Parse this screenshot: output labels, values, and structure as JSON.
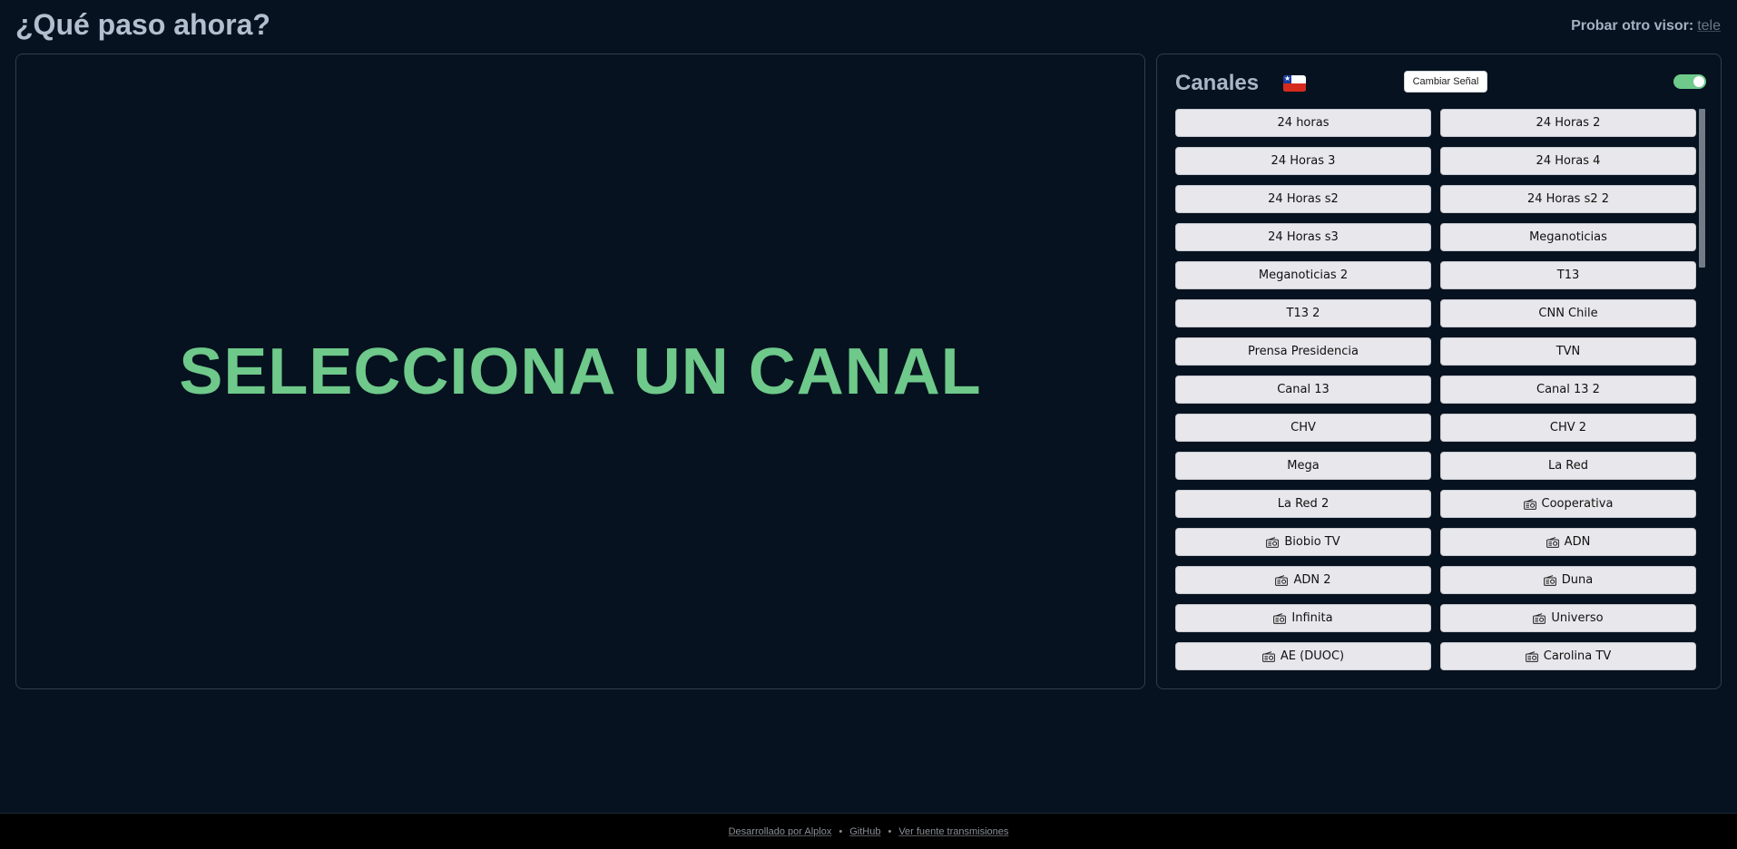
{
  "header": {
    "title": "¿Qué paso ahora?",
    "alt_viewer_label": "Probar otro visor:",
    "alt_viewer_link": "tele"
  },
  "player": {
    "message": "SELECCIONA UN CANAL"
  },
  "sidebar": {
    "title": "Canales",
    "flag": "chile-flag-icon",
    "signal_button": "Cambiar Señal",
    "toggle_on": true,
    "accent_color": "#6ec98a"
  },
  "channels": [
    {
      "label": "24 horas",
      "radio": false
    },
    {
      "label": "24 Horas 2",
      "radio": false
    },
    {
      "label": "24 Horas 3",
      "radio": false
    },
    {
      "label": "24 Horas 4",
      "radio": false
    },
    {
      "label": "24 Horas s2",
      "radio": false
    },
    {
      "label": "24 Horas s2 2",
      "radio": false
    },
    {
      "label": "24 Horas s3",
      "radio": false
    },
    {
      "label": "Meganoticias",
      "radio": false
    },
    {
      "label": "Meganoticias 2",
      "radio": false
    },
    {
      "label": "T13",
      "radio": false
    },
    {
      "label": "T13 2",
      "radio": false
    },
    {
      "label": "CNN Chile",
      "radio": false
    },
    {
      "label": "Prensa Presidencia",
      "radio": false
    },
    {
      "label": "TVN",
      "radio": false
    },
    {
      "label": "Canal 13",
      "radio": false
    },
    {
      "label": "Canal 13 2",
      "radio": false
    },
    {
      "label": "CHV",
      "radio": false
    },
    {
      "label": "CHV 2",
      "radio": false
    },
    {
      "label": "Mega",
      "radio": false
    },
    {
      "label": "La Red",
      "radio": false
    },
    {
      "label": "La Red 2",
      "radio": false
    },
    {
      "label": "Cooperativa",
      "radio": true
    },
    {
      "label": "Biobio TV",
      "radio": true
    },
    {
      "label": "ADN",
      "radio": true
    },
    {
      "label": "ADN 2",
      "radio": true
    },
    {
      "label": "Duna",
      "radio": true
    },
    {
      "label": "Infinita",
      "radio": true
    },
    {
      "label": "Universo",
      "radio": true
    },
    {
      "label": "AE (DUOC)",
      "radio": true
    },
    {
      "label": "Carolina TV",
      "radio": true
    }
  ],
  "footer": {
    "credit": "Desarrollado por Alplox",
    "github": "GitHub",
    "sources": "Ver fuente transmisiones",
    "separator": "•"
  }
}
